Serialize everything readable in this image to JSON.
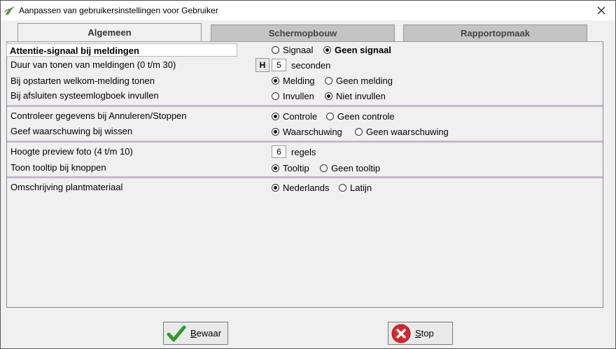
{
  "window": {
    "title": "Aanpassen van gebruikersinstellingen voor Gebruiker"
  },
  "tabs": [
    {
      "label": "Algemeen"
    },
    {
      "label": "Schermopbouw"
    },
    {
      "label": "Rapportopmaak"
    }
  ],
  "settings": {
    "attention": {
      "label": "Attentie-signaal bij meldingen",
      "opt1": "Signaal",
      "opt2": "Geen signaal",
      "selected": "opt2"
    },
    "duration": {
      "label": "Duur van tonen van meldingen (0 t/m 30)",
      "hbtn": "H",
      "value": "5",
      "unit": "seconden"
    },
    "welcome": {
      "label": "Bij opstarten welkom-melding tonen",
      "opt1": "Melding",
      "opt2": "Geen melding",
      "selected": "opt1"
    },
    "syslog": {
      "label": "Bij afsluiten systeemlogboek invullen",
      "opt1": "Invullen",
      "opt2": "Niet invullen",
      "selected": "opt2"
    },
    "check": {
      "label": "Controleer gegevens bij Annuleren/Stoppen",
      "opt1": "Controle",
      "opt2": "Geen controle",
      "selected": "opt1"
    },
    "warning": {
      "label": "Geef waarschuwing bij wissen",
      "opt1": "Waarschuwing",
      "opt2": "Geen waarschuwing",
      "selected": "opt1"
    },
    "preview": {
      "label": "Hoogte preview foto (4 t/m 10)",
      "value": "6",
      "unit": "regels"
    },
    "tooltip": {
      "label": "Toon tooltip bij knoppen",
      "opt1": "Tooltip",
      "opt2": "Geen tooltip",
      "selected": "opt1"
    },
    "plant": {
      "label": "Omschrijving plantmateriaal",
      "opt1": "Nederlands",
      "opt2": "Latijn",
      "selected": "opt1"
    }
  },
  "buttons": {
    "save": {
      "mnemonic": "B",
      "rest": "ewaar",
      "icon": "checkmark-icon",
      "color": "#2e9a2e"
    },
    "stop": {
      "mnemonic": "S",
      "rest": "top",
      "icon": "stop-icon",
      "color": "#d8262e"
    }
  }
}
